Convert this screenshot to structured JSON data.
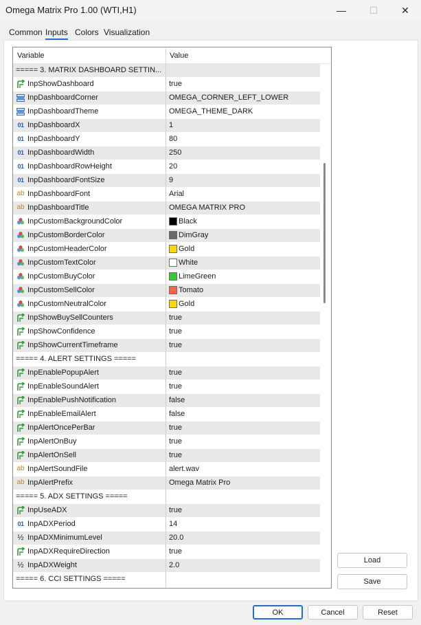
{
  "window": {
    "title": "Omega Matrix Pro 1.00 (WTI,H1)",
    "min_glyph": "—",
    "max_glyph": "☐",
    "close_glyph": "✕"
  },
  "tabs": [
    {
      "label": "Common"
    },
    {
      "label": "Inputs"
    },
    {
      "label": "Colors"
    },
    {
      "label": "Visualization"
    }
  ],
  "active_tab": "Inputs",
  "grid": {
    "col_variable": "Variable",
    "col_value": "Value",
    "rows": [
      {
        "type": "section",
        "name": "===== 3. MATRIX DASHBOARD SETTIN...",
        "value": ""
      },
      {
        "type": "bool",
        "name": "InpShowDashboard",
        "value": "true"
      },
      {
        "type": "enum",
        "name": "InpDashboardCorner",
        "value": "OMEGA_CORNER_LEFT_LOWER"
      },
      {
        "type": "enum",
        "name": "InpDashboardTheme",
        "value": "OMEGA_THEME_DARK"
      },
      {
        "type": "int",
        "name": "InpDashboardX",
        "value": "1"
      },
      {
        "type": "int",
        "name": "InpDashboardY",
        "value": "80"
      },
      {
        "type": "int",
        "name": "InpDashboardWidth",
        "value": "250"
      },
      {
        "type": "int",
        "name": "InpDashboardRowHeight",
        "value": "20"
      },
      {
        "type": "int",
        "name": "InpDashboardFontSize",
        "value": "9"
      },
      {
        "type": "string",
        "name": "InpDashboardFont",
        "value": "Arial"
      },
      {
        "type": "string",
        "name": "InpDashboardTitle",
        "value": "OMEGA MATRIX PRO"
      },
      {
        "type": "color",
        "name": "InpCustomBackgroundColor",
        "value": "Black",
        "swatch": "#000000"
      },
      {
        "type": "color",
        "name": "InpCustomBorderColor",
        "value": "DimGray",
        "swatch": "#696969"
      },
      {
        "type": "color",
        "name": "InpCustomHeaderColor",
        "value": "Gold",
        "swatch": "#ffd700"
      },
      {
        "type": "color",
        "name": "InpCustomTextColor",
        "value": "White",
        "swatch": "#ffffff"
      },
      {
        "type": "color",
        "name": "InpCustomBuyColor",
        "value": "LimeGreen",
        "swatch": "#32cd32"
      },
      {
        "type": "color",
        "name": "InpCustomSellColor",
        "value": "Tomato",
        "swatch": "#ff6347"
      },
      {
        "type": "color",
        "name": "InpCustomNeutralColor",
        "value": "Gold",
        "swatch": "#ffd700"
      },
      {
        "type": "bool",
        "name": "InpShowBuySellCounters",
        "value": "true"
      },
      {
        "type": "bool",
        "name": "InpShowConfidence",
        "value": "true"
      },
      {
        "type": "bool",
        "name": "InpShowCurrentTimeframe",
        "value": "true"
      },
      {
        "type": "section",
        "name": "===== 4. ALERT SETTINGS =====",
        "value": ""
      },
      {
        "type": "bool",
        "name": "InpEnablePopupAlert",
        "value": "true"
      },
      {
        "type": "bool",
        "name": "InpEnableSoundAlert",
        "value": "true"
      },
      {
        "type": "bool",
        "name": "InpEnablePushNotification",
        "value": "false"
      },
      {
        "type": "bool",
        "name": "InpEnableEmailAlert",
        "value": "false"
      },
      {
        "type": "bool",
        "name": "InpAlertOncePerBar",
        "value": "true"
      },
      {
        "type": "bool",
        "name": "InpAlertOnBuy",
        "value": "true"
      },
      {
        "type": "bool",
        "name": "InpAlertOnSell",
        "value": "true"
      },
      {
        "type": "string",
        "name": "InpAlertSoundFile",
        "value": "alert.wav"
      },
      {
        "type": "string",
        "name": "InpAlertPrefix",
        "value": "Omega Matrix Pro"
      },
      {
        "type": "section",
        "name": "===== 5. ADX SETTINGS =====",
        "value": ""
      },
      {
        "type": "bool",
        "name": "InpUseADX",
        "value": "true"
      },
      {
        "type": "int",
        "name": "InpADXPeriod",
        "value": "14"
      },
      {
        "type": "double",
        "name": "InpADXMinimumLevel",
        "value": "20.0"
      },
      {
        "type": "bool",
        "name": "InpADXRequireDirection",
        "value": "true"
      },
      {
        "type": "double",
        "name": "InpADXWeight",
        "value": "2.0"
      },
      {
        "type": "section",
        "name": "===== 6. CCI SETTINGS =====",
        "value": ""
      }
    ]
  },
  "buttons": {
    "load": "Load",
    "save": "Save",
    "ok": "OK",
    "cancel": "Cancel",
    "reset": "Reset"
  },
  "colors": {
    "accent": "#1f6fd1",
    "row_shade": "#e8e8e8"
  }
}
